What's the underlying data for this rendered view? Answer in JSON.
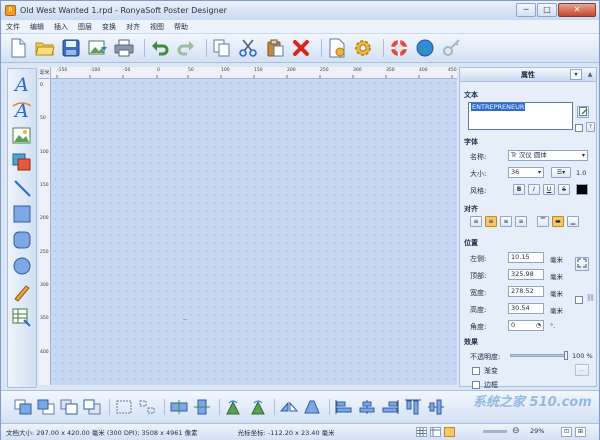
{
  "app_title": "Old West Wanted 1.rpd - RonyaSoft Poster Designer",
  "window_buttons": {
    "minimize": "─",
    "maximize": "□",
    "close": "✕"
  },
  "menu": [
    "文件",
    "编辑",
    "插入",
    "图层",
    "变换",
    "对齐",
    "视图",
    "帮助"
  ],
  "ruler": {
    "corner": "毫米",
    "h_ticks": [
      "-150",
      "-100",
      "-50",
      "0",
      "50",
      "100",
      "150",
      "200",
      "250",
      "300",
      "350",
      "400",
      "450"
    ],
    "v_ticks": [
      "0",
      "50",
      "100",
      "150",
      "200",
      "250",
      "300",
      "350",
      "400"
    ]
  },
  "panel": {
    "title": "属性",
    "text_section": "文本",
    "text_value": "ENTREPRENEUR",
    "font_section": "字体",
    "font_name_label": "名称:",
    "font_name_value": "Tr 汉仪 圆体",
    "font_size_label": "大小:",
    "font_size_value": "36",
    "line_spacing_value": "1.0",
    "style_label": "风格:",
    "style_buttons": [
      "B",
      "I",
      "U",
      "S"
    ],
    "align_section": "对齐",
    "position_section": "位置",
    "left_label": "左侧:",
    "left_value": "10.15",
    "top_label": "顶部:",
    "top_value": "325.98",
    "width_label": "宽度:",
    "width_value": "278.52",
    "height_label": "高度:",
    "height_value": "30.54",
    "angle_label": "角度:",
    "angle_value": "0",
    "unit_mm": "毫米",
    "unit_deg": "°.",
    "effects_section": "效果",
    "opacity_label": "不透明度:",
    "opacity_value": "100 %",
    "gradient_label": "渐变",
    "border_label": "边框"
  },
  "status": {
    "doc_size": "文档大小: 297.00 x 420.00 毫米 (300 DPI); 3508 x 4961 像素",
    "cursor": "光标坐标: -112.20 x 23.40 毫米",
    "zoom": "29%"
  },
  "watermark": "系统之家 510.com",
  "colors": {
    "accent": "#2a6ad1",
    "canvas": "#c6d8f2",
    "delete_red": "#d9261c"
  }
}
